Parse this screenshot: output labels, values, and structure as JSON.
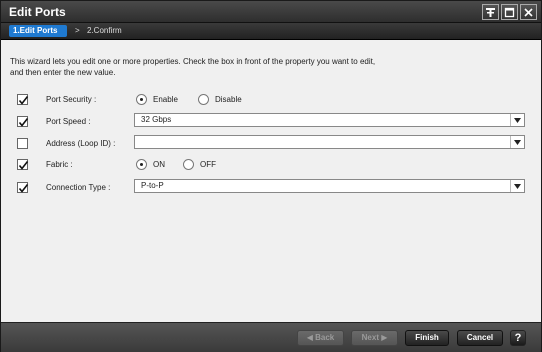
{
  "window": {
    "title": "Edit Ports"
  },
  "steps": {
    "active": "1.Edit Ports",
    "separator": ">",
    "next": "2.Confirm"
  },
  "intro": {
    "line1": "This wizard lets you edit one or more properties. Check the  box in front of the property you want to edit,",
    "line2": "and then enter the new value."
  },
  "rows": {
    "port_security": {
      "checked": true,
      "label": "Port Security :",
      "options": [
        "Enable",
        "Disable"
      ],
      "selected": "Enable"
    },
    "port_speed": {
      "checked": true,
      "label": "Port Speed :",
      "value": "32 Gbps"
    },
    "address": {
      "checked": false,
      "label": "Address (Loop ID) :",
      "value": ""
    },
    "fabric": {
      "checked": true,
      "label": "Fabric :",
      "options": [
        "ON",
        "OFF"
      ],
      "selected": "ON"
    },
    "connection_type": {
      "checked": true,
      "label": "Connection Type :",
      "value": "P-to-P"
    }
  },
  "footer": {
    "back_label": "◀ Back",
    "next_label": "Next ▶",
    "finish_label": "Finish",
    "cancel_label": "Cancel",
    "help_label": "?"
  },
  "colors": {
    "accent": "#1f7ad1",
    "titlebar": "#2e2e2e"
  }
}
